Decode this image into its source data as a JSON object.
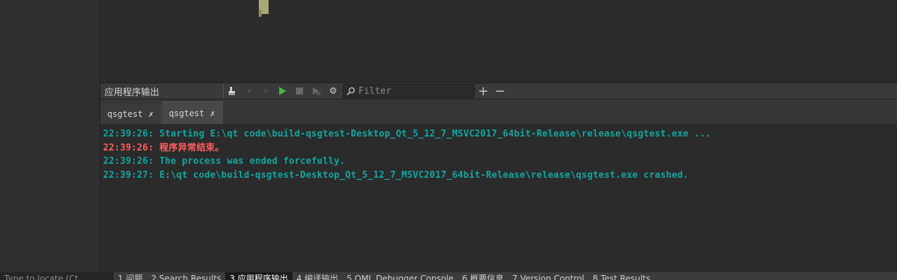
{
  "toolbar": {
    "title": "应用程序输出",
    "filter_placeholder": "Filter",
    "plus": "+",
    "minus": "−"
  },
  "tabs": [
    {
      "label": "qsgtest",
      "active": false
    },
    {
      "label": "qsgtest",
      "active": true
    }
  ],
  "output_lines": [
    {
      "text": "22:39:26: Starting E:\\qt code\\build-qsgtest-Desktop_Qt_5_12_7_MSVC2017_64bit-Release\\release\\qsgtest.exe ...",
      "kind": "info"
    },
    {
      "text": "22:39:26: 程序异常结束。",
      "kind": "error"
    },
    {
      "text": "22:39:26: The process was ended forcefully.",
      "kind": "info"
    },
    {
      "text": "22:39:27: E:\\qt code\\build-qsgtest-Desktop_Qt_5_12_7_MSVC2017_64bit-Release\\release\\qsgtest.exe crashed.",
      "kind": "info"
    }
  ],
  "statusbar": {
    "locator": "Type to locate (Ct",
    "items": [
      {
        "label": "1 问题",
        "active": false
      },
      {
        "label": "2 Search Results",
        "active": false
      },
      {
        "label": "3 应用程序输出",
        "active": true
      },
      {
        "label": "4 编译输出",
        "active": false
      },
      {
        "label": "5 QML Debugger Console",
        "active": false
      },
      {
        "label": "6 概要信息",
        "active": false
      },
      {
        "label": "7 Version Control",
        "active": false
      },
      {
        "label": "8 Test Results",
        "active": false
      }
    ]
  },
  "colors": {
    "info": "#12a6a0",
    "error": "#ff5f5f",
    "play": "#3dbb3d"
  }
}
